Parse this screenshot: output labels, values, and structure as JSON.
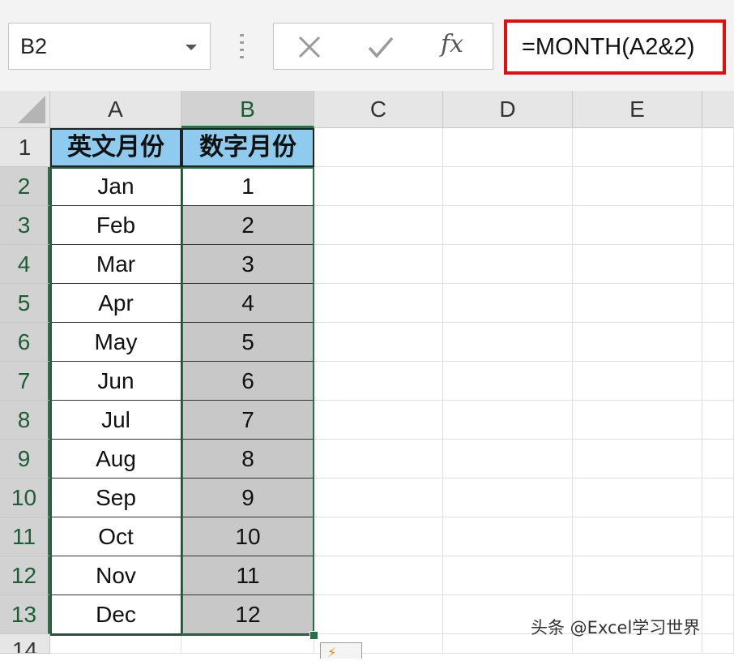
{
  "name_box": {
    "value": "B2"
  },
  "formula": {
    "text": "=MONTH(A2&2)"
  },
  "icons": {
    "cancel": "cancel-x-icon",
    "enter": "enter-check-icon",
    "function": "fx-icon",
    "fx_glyph": "fx"
  },
  "columns": [
    "A",
    "B",
    "C",
    "D",
    "E"
  ],
  "rows": [
    "1",
    "2",
    "3",
    "4",
    "5",
    "6",
    "7",
    "8",
    "9",
    "10",
    "11",
    "12",
    "13",
    "14"
  ],
  "header": {
    "a": "英文月份",
    "b": "数字月份"
  },
  "months": [
    {
      "en": "Jan",
      "num": "1"
    },
    {
      "en": "Feb",
      "num": "2"
    },
    {
      "en": "Mar",
      "num": "3"
    },
    {
      "en": "Apr",
      "num": "4"
    },
    {
      "en": "May",
      "num": "5"
    },
    {
      "en": "Jun",
      "num": "6"
    },
    {
      "en": "Jul",
      "num": "7"
    },
    {
      "en": "Aug",
      "num": "8"
    },
    {
      "en": "Sep",
      "num": "9"
    },
    {
      "en": "Oct",
      "num": "10"
    },
    {
      "en": "Nov",
      "num": "11"
    },
    {
      "en": "Dec",
      "num": "12"
    }
  ],
  "watermark": "头条 @Excel学习世界",
  "colors": {
    "header_fill": "#8ecbef",
    "selected_fill": "#c8c8c8",
    "selection_border": "#217346",
    "formula_highlight": "#e01010"
  }
}
